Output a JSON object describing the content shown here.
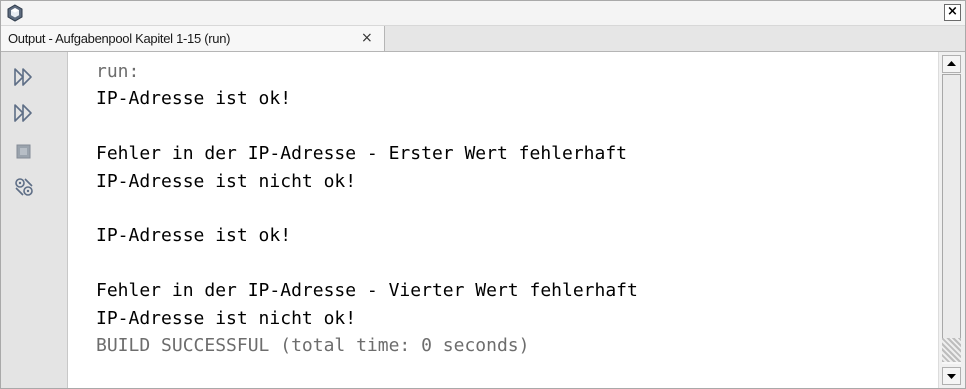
{
  "window": {
    "icon": "netbeans-cube-icon",
    "close_label": "×"
  },
  "tab": {
    "label": "Output - Aufgabenpool Kapitel 1-15 (run)",
    "close_label": "×"
  },
  "toolbar": {
    "buttons": [
      {
        "name": "rerun-icon",
        "label": ""
      },
      {
        "name": "rerun-with-options-icon",
        "label": ""
      },
      {
        "name": "stop-icon",
        "label": ""
      },
      {
        "name": "settings-icon",
        "label": ""
      }
    ]
  },
  "output": {
    "lines": [
      {
        "text": "run:",
        "kind": "meta"
      },
      {
        "text": "IP-Adresse ist ok!",
        "kind": "out"
      },
      {
        "text": "",
        "kind": "out"
      },
      {
        "text": "Fehler in der IP-Adresse - Erster Wert fehlerhaft",
        "kind": "out"
      },
      {
        "text": "IP-Adresse ist nicht ok!",
        "kind": "out"
      },
      {
        "text": "",
        "kind": "out"
      },
      {
        "text": "IP-Adresse ist ok!",
        "kind": "out"
      },
      {
        "text": "",
        "kind": "out"
      },
      {
        "text": "Fehler in der IP-Adresse - Vierter Wert fehlerhaft",
        "kind": "out"
      },
      {
        "text": "IP-Adresse ist nicht ok!",
        "kind": "out"
      },
      {
        "text": "BUILD SUCCESSFUL (total time: 0 seconds)",
        "kind": "meta"
      }
    ]
  },
  "colors": {
    "meta_text": "#6d6d6d",
    "output_text": "#000000",
    "toolbar_icon": "#6f7f95"
  }
}
